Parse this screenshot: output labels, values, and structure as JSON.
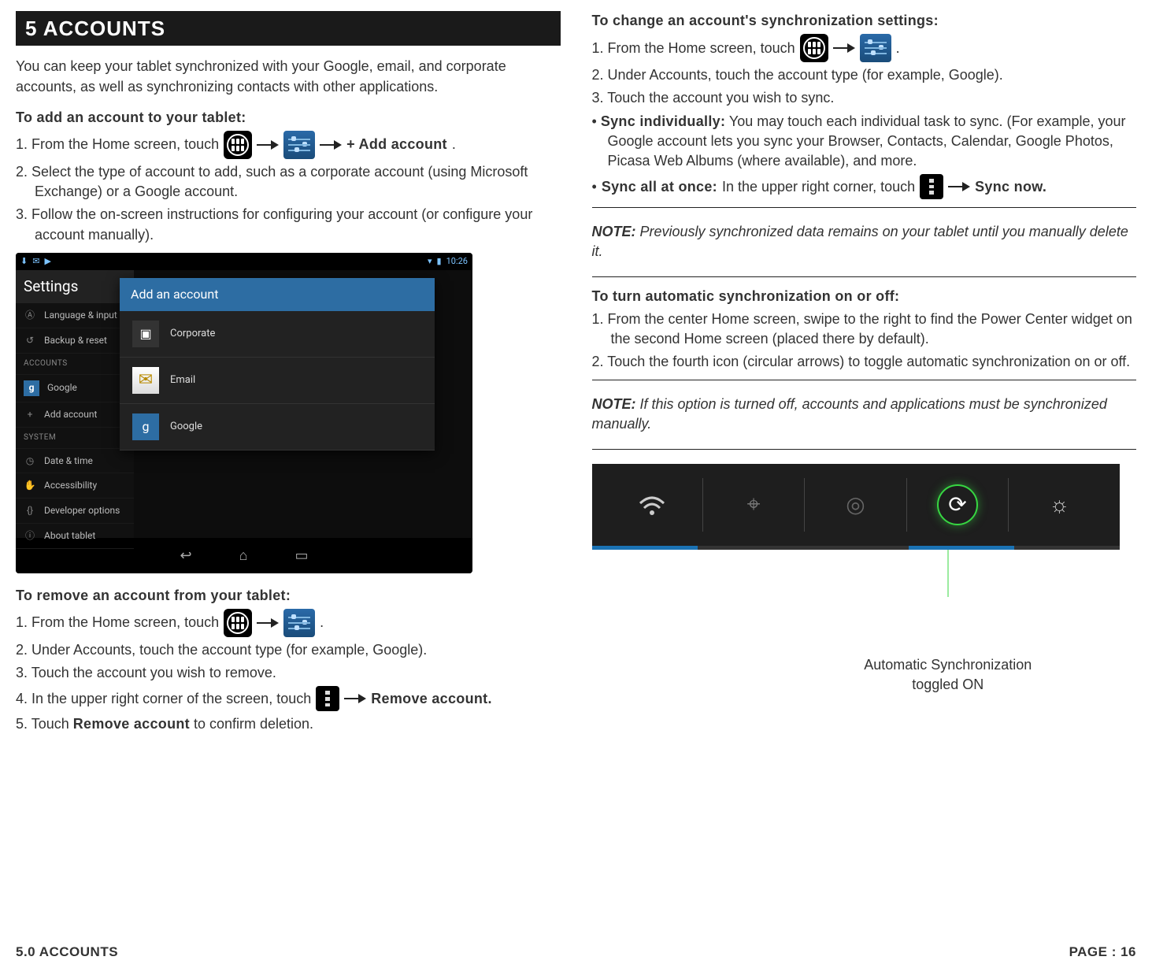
{
  "header": {
    "title": "5 ACCOUNTS"
  },
  "left": {
    "intro": "You can keep your tablet synchronized with your Google, email, and corporate accounts, as well as synchronizing contacts with other applications.",
    "add": {
      "head": "To add an account to your tablet:",
      "s1a": "1. From the Home screen, touch",
      "s1d": "+ Add account",
      "s1e": ".",
      "s2": "2. Select the type of account to add, such as a corporate account (using Microsoft Exchange) or a Google account.",
      "s3": "3. Follow the on-screen instructions for configuring your account (or configure your account manually)."
    },
    "android": {
      "statusbar_time": "10:26",
      "sidebar_title": "Settings",
      "items": {
        "lang": "Language & input",
        "backup": "Backup & reset",
        "sec_accounts": "ACCOUNTS",
        "google": "Google",
        "add": "Add account",
        "sec_system": "SYSTEM",
        "date": "Date & time",
        "access": "Accessibility",
        "dev": "Developer options",
        "about": "About tablet"
      },
      "dialog": {
        "title": "Add an account",
        "corporate": "Corporate",
        "email": "Email",
        "google": "Google"
      }
    },
    "remove": {
      "head": "To remove an account from your tablet:",
      "s1a": "1. From the Home screen, touch",
      "s1d": ".",
      "s2": "2. Under Accounts, touch the account type (for example, Google).",
      "s3": "3. Touch the account you wish to remove.",
      "s4a": "4. In the upper right corner of the screen, touch",
      "s4c": "Remove account.",
      "s5a": "5. Touch ",
      "s5b": "Remove account",
      "s5c": " to confirm deletion."
    }
  },
  "right": {
    "change": {
      "head": "To change an account's synchronization settings:",
      "s1a": "1. From the Home screen, touch",
      "s1d": ".",
      "s2": "2. Under Accounts, touch the account type (for example, Google).",
      "s3": "3. Touch the account you wish to sync.",
      "b1_lead": "• ",
      "b1_bold": "Sync individually:",
      "b1_rest": " You may touch each individual task to sync. (For example, your Google account lets you sync your Browser, Contacts, Calendar, Google Photos, Picasa Web Albums (where available), and more.",
      "b2_lead": "• ",
      "b2_bold": "Sync all at once:",
      "b2_mid": " In the upper right corner, touch",
      "b2_end": "Sync now."
    },
    "note1": {
      "label": "NOTE:",
      "body": " Previously synchronized data remains on your tablet until you manually delete it."
    },
    "auto": {
      "head": "To turn automatic synchronization on or off:",
      "s1": "1. From the center Home screen, swipe to the right to find the Power Center widget on the second Home screen (placed there by default).",
      "s2": "2. Touch the fourth icon (circular arrows) to toggle automatic synchronization on or off."
    },
    "note2": {
      "label": "NOTE:",
      "body": " If this option is turned off, accounts and applications must be synchronized manually."
    },
    "caption": {
      "line1": "Automatic Synchronization",
      "line2": "toggled ON"
    }
  },
  "footer": {
    "left": "5.0 ACCOUNTS",
    "right": "PAGE : 16"
  }
}
